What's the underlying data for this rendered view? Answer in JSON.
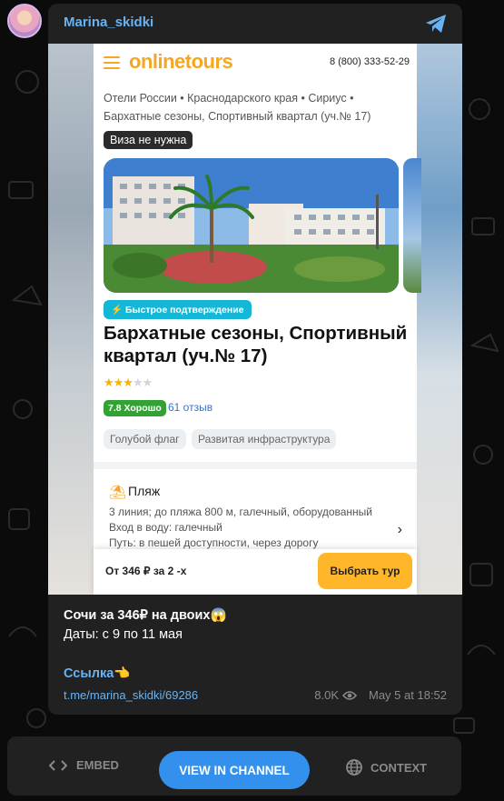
{
  "channel": {
    "name": "Marina_skidki"
  },
  "screenshot": {
    "logo": "onlinetours",
    "phone": "8 (800) 333-52-29",
    "breadcrumbs": "Отели России • Краснодарского края • Сириус • Бархатные сезоны, Спортивный квартал (уч.№ 17)",
    "visa_badge": "Виза не нужна",
    "fast_badge": "⚡ Быстрое подтверждение",
    "hotel_title": "Бархатные сезоны, Спортивный квартал (уч.№ 17)",
    "stars_rating": 3,
    "stars_max": 5,
    "rating_badge": "7.8 Хорошо",
    "reviews": "61 отзыв",
    "tags": [
      "Голубой флаг",
      "Развитая инфраструктура"
    ],
    "beach_title": "Пляж",
    "beach_lines": [
      "3 линия; до пляжа 800 м, галечный, оборудованный",
      "Вход в воду: галечный",
      "Путь: в пешей доступности, через дорогу"
    ],
    "price": "От 346 ₽ за 2 -х",
    "choose_button": "Выбрать тур"
  },
  "caption": {
    "line1": "Сочи за 346₽ на двоих😱",
    "line2": "Даты: с 9 по 11 мая",
    "link_text": "Ссылка👈",
    "url": "t.me/marina_skidki/69286",
    "views": "8.0K",
    "date": "May 5 at 18:52"
  },
  "footer": {
    "embed": "EMBED",
    "view_in_channel": "VIEW IN CHANNEL",
    "context": "CONTEXT"
  },
  "colors": {
    "accent": "#6ab3f3",
    "button": "#3390ec",
    "card": "#212121",
    "orange": "#ffb628"
  }
}
